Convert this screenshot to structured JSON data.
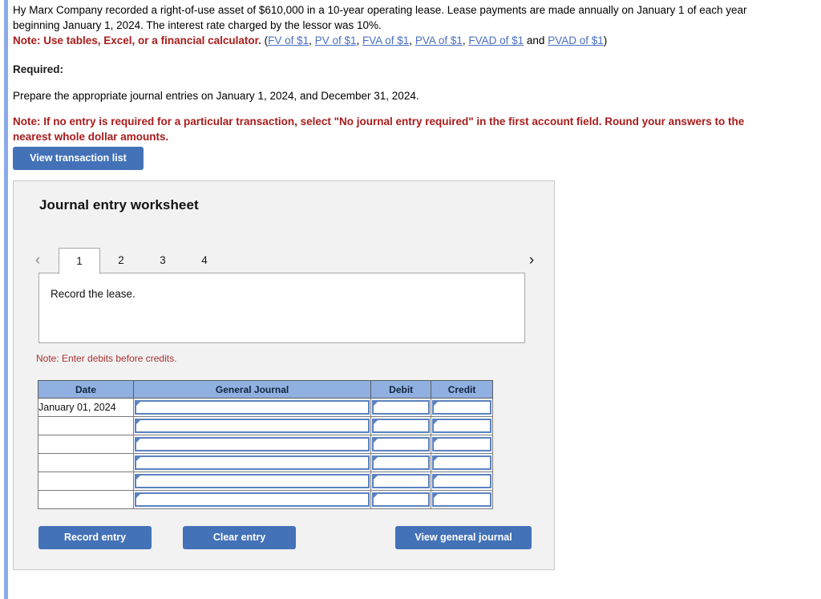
{
  "problem": {
    "line1": "Hy Marx Company recorded a right-of-use asset of $610,000 in a 10-year operating lease. Lease payments are made annually on January 1 of each year beginning January 1, 2024. The interest rate charged by the lessor was 10%.",
    "note_label": "Note: Use tables, Excel, or a financial calculator.",
    "links_open": "(",
    "links": [
      {
        "text": "FV of $1",
        "sep": ", "
      },
      {
        "text": "PV of $1",
        "sep": ", "
      },
      {
        "text": "FVA of $1",
        "sep": ", "
      },
      {
        "text": "PVA of $1",
        "sep": ", "
      },
      {
        "text": "FVAD of $1",
        "sep": " and "
      },
      {
        "text": "PVAD of $1",
        "sep": ""
      }
    ],
    "links_close": ")"
  },
  "required": {
    "heading": "Required:",
    "instruction": "Prepare the appropriate journal entries on January 1, 2024, and December 31, 2024.",
    "note": "Note: If no entry is required for a particular transaction, select \"No journal entry required\" in the first account field. Round your answers to the nearest whole dollar amounts."
  },
  "toolbar": {
    "view_transaction_list_label": "View transaction list"
  },
  "worksheet": {
    "title": "Journal entry worksheet",
    "tabs": [
      {
        "label": "1",
        "active": true
      },
      {
        "label": "2",
        "active": false
      },
      {
        "label": "3",
        "active": false
      },
      {
        "label": "4",
        "active": false
      }
    ],
    "prev_arrow": "‹",
    "next_arrow": "›",
    "description": "Record the lease.",
    "debit_note": "Note: Enter debits before credits.",
    "table": {
      "headers": [
        "Date",
        "General Journal",
        "Debit",
        "Credit"
      ],
      "rows": [
        {
          "date": "January 01, 2024",
          "general_journal": "",
          "debit": "",
          "credit": ""
        },
        {
          "date": "",
          "general_journal": "",
          "debit": "",
          "credit": ""
        },
        {
          "date": "",
          "general_journal": "",
          "debit": "",
          "credit": ""
        },
        {
          "date": "",
          "general_journal": "",
          "debit": "",
          "credit": ""
        },
        {
          "date": "",
          "general_journal": "",
          "debit": "",
          "credit": ""
        },
        {
          "date": "",
          "general_journal": "",
          "debit": "",
          "credit": ""
        }
      ]
    },
    "buttons": {
      "record_entry": "Record entry",
      "clear_entry": "Clear entry",
      "view_general_journal": "View general journal"
    }
  },
  "colors": {
    "accent_blue": "#4472b8",
    "note_red": "#aa1b1b",
    "link_blue": "#4a6fc0",
    "table_header_blue": "#8fb0e0",
    "left_bar": "#8ca9e8"
  }
}
